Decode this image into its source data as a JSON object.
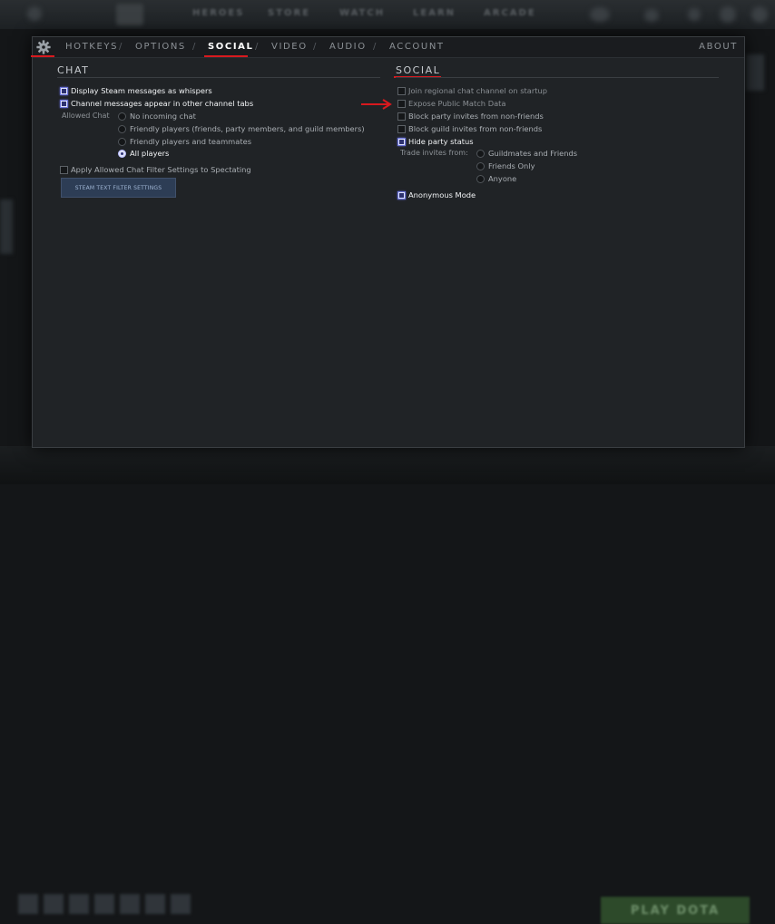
{
  "background": {
    "nav": [
      "HEROES",
      "STORE",
      "WATCH",
      "LEARN",
      "ARCADE"
    ],
    "play_button": "PLAY DOTA"
  },
  "tabs": {
    "items": [
      {
        "label": "HOTKEYS",
        "active": false
      },
      {
        "label": "OPTIONS",
        "active": false
      },
      {
        "label": "SOCIAL",
        "active": true
      },
      {
        "label": "VIDEO",
        "active": false
      },
      {
        "label": "AUDIO",
        "active": false
      },
      {
        "label": "ACCOUNT",
        "active": false
      }
    ],
    "separator": "/",
    "about": "ABOUT"
  },
  "chat": {
    "title": "CHAT",
    "whispers": {
      "label": "Display Steam messages as whispers",
      "checked": true
    },
    "channel_tabs": {
      "label": "Channel messages appear in other channel tabs",
      "checked": true
    },
    "allowed_chat_label": "Allowed Chat",
    "allowed_chat_options": [
      {
        "label": "No incoming chat",
        "selected": false
      },
      {
        "label": "Friendly players (friends, party members, and guild members)",
        "selected": false
      },
      {
        "label": "Friendly players and teammates",
        "selected": false
      },
      {
        "label": "All players",
        "selected": true
      }
    ],
    "spectating": {
      "label": "Apply Allowed Chat Filter Settings to Spectating",
      "checked": false
    },
    "filter_button": "STEAM TEXT FILTER SETTINGS"
  },
  "social": {
    "title": "SOCIAL",
    "join_regional": {
      "label": "Join regional chat channel on startup",
      "checked": false
    },
    "expose_public": {
      "label": "Expose Public Match Data",
      "checked": false
    },
    "block_party": {
      "label": "Block party invites from non-friends",
      "checked": false
    },
    "block_guild": {
      "label": "Block guild invites from non-friends",
      "checked": false
    },
    "hide_party": {
      "label": "Hide party status",
      "checked": true
    },
    "trade_label": "Trade invites from:",
    "trade_options": [
      {
        "label": "Guildmates and Friends",
        "selected": false
      },
      {
        "label": "Friends Only",
        "selected": false
      },
      {
        "label": "Anyone",
        "selected": false
      }
    ],
    "anonymous": {
      "label": "Anonymous Mode",
      "checked": true
    }
  },
  "colors": {
    "accent_red": "#d8191e",
    "checkbox_on": "#dfe3ff"
  }
}
